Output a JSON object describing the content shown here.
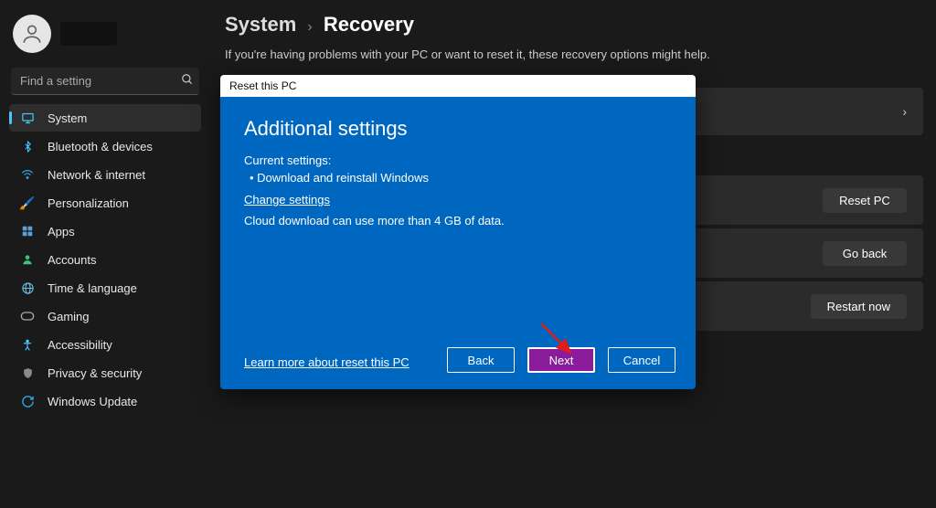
{
  "search": {
    "placeholder": "Find a setting"
  },
  "nav": [
    {
      "label": "System",
      "icon": "🖥️",
      "color": "#4cc2ff"
    },
    {
      "label": "Bluetooth & devices",
      "icon": "bt",
      "color": "#4cc2ff"
    },
    {
      "label": "Network & internet",
      "icon": "wifi",
      "color": "#2ca7e0"
    },
    {
      "label": "Personalization",
      "icon": "🖌️",
      "color": "#e06c9f"
    },
    {
      "label": "Apps",
      "icon": "apps",
      "color": "#5aa0d8"
    },
    {
      "label": "Accounts",
      "icon": "👤",
      "color": "#3cc47c"
    },
    {
      "label": "Time & language",
      "icon": "🌐",
      "color": "#6fb8e0"
    },
    {
      "label": "Gaming",
      "icon": "🎮",
      "color": "#9a9a9a"
    },
    {
      "label": "Accessibility",
      "icon": "acc",
      "color": "#4cc2ff"
    },
    {
      "label": "Privacy & security",
      "icon": "🛡️",
      "color": "#8a8a8a"
    },
    {
      "label": "Windows Update",
      "icon": "🔄",
      "color": "#2ca7e0"
    }
  ],
  "breadcrumb": {
    "parent": "System",
    "current": "Recovery"
  },
  "page_desc": "If you're having problems with your PC or want to reset it, these recovery options might help.",
  "card_buttons": {
    "reset": "Reset PC",
    "goback": "Go back",
    "restart": "Restart now"
  },
  "dialog": {
    "title": "Reset this PC",
    "heading": "Additional settings",
    "current_label": "Current settings:",
    "bullet": "•  Download and reinstall Windows",
    "change": "Change settings",
    "note": "Cloud download can use more than 4 GB of data.",
    "learn": "Learn more about reset this PC",
    "back": "Back",
    "next": "Next",
    "cancel": "Cancel"
  }
}
